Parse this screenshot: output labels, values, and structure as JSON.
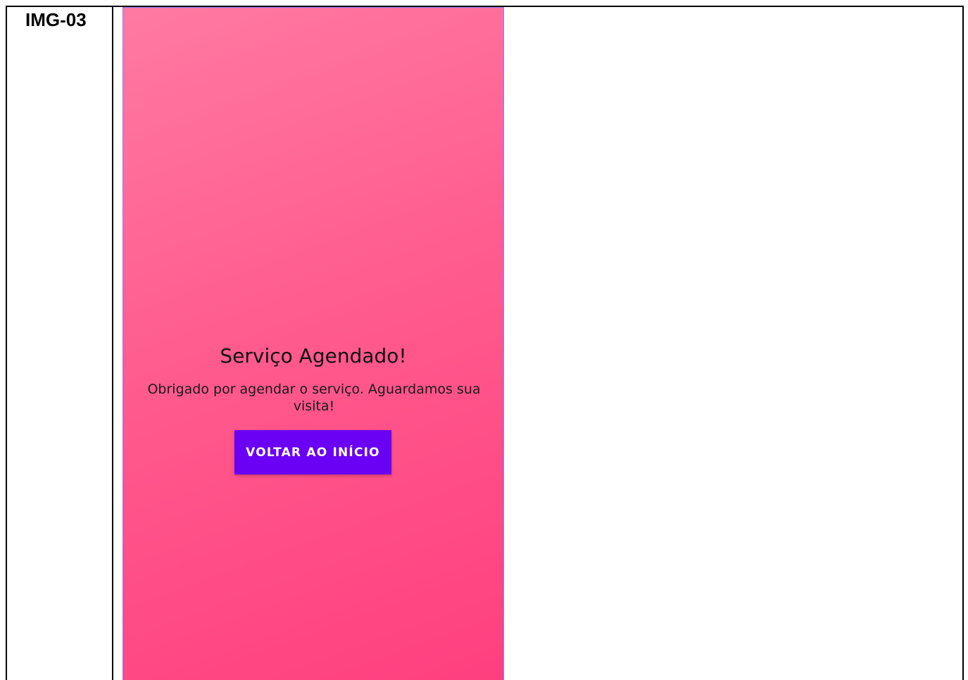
{
  "document": {
    "image_label": "IMG-03"
  },
  "screen": {
    "title": "Serviço Agendado!",
    "message": "Obrigado por agendar o serviço. Aguardamos sua visita!",
    "home_button_label": "VOLTAR AO INÍCIO"
  },
  "colors": {
    "background_gradient_top": "#ff7aa2",
    "background_gradient_bottom": "#ff3f7f",
    "button": "#6a00f4",
    "button_text": "#ffffff"
  }
}
